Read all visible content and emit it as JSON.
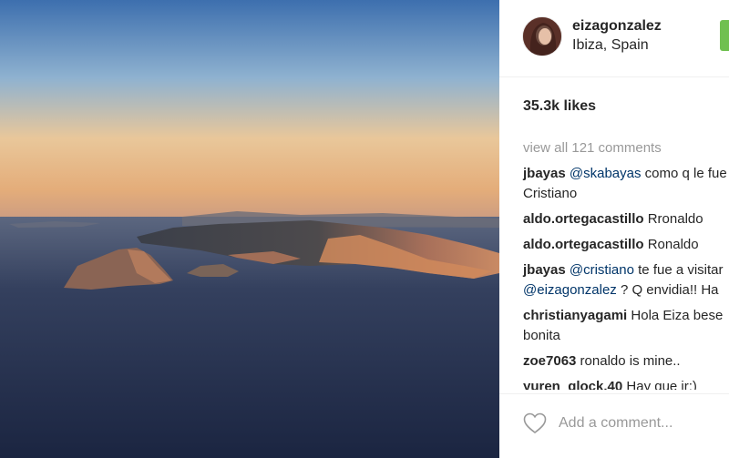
{
  "post": {
    "image_alt": "Aerial sunset view of Ibiza coastline",
    "username": "eizagonzalez",
    "location": "Ibiza, Spain",
    "likes": "35.3k likes",
    "view_all": "view all 121 comments",
    "add_comment_placeholder": "Add a comment..."
  },
  "comments": [
    {
      "user": "jbayas",
      "parts": [
        {
          "type": "mention",
          "text": "@skabayas"
        },
        {
          "type": "text",
          "text": " como q le fue"
        }
      ],
      "line2": "Cristiano"
    },
    {
      "user": "aldo.ortegacastillo",
      "parts": [
        {
          "type": "text",
          "text": "Rronaldo"
        }
      ]
    },
    {
      "user": "aldo.ortegacastillo",
      "parts": [
        {
          "type": "text",
          "text": "Ronaldo"
        }
      ]
    },
    {
      "user": "jbayas",
      "parts": [
        {
          "type": "mention",
          "text": "@cristiano"
        },
        {
          "type": "text",
          "text": " te fue a visitar"
        }
      ],
      "line2_mention": "@eizagonzalez",
      "line2_text": " ? Q envidia!! Ha"
    },
    {
      "user": "christianyagami",
      "parts": [
        {
          "type": "text",
          "text": "Hola Eiza bese"
        }
      ],
      "line2": "bonita"
    },
    {
      "user": "zoe7063",
      "parts": [
        {
          "type": "text",
          "text": "ronaldo is mine.."
        }
      ]
    },
    {
      "user": "yuren_glock.40",
      "parts": [
        {
          "type": "text",
          "text": "Hay que ir;)"
        }
      ]
    }
  ],
  "colors": {
    "follow": "#70c050",
    "mention": "#003569",
    "muted": "#999999"
  }
}
